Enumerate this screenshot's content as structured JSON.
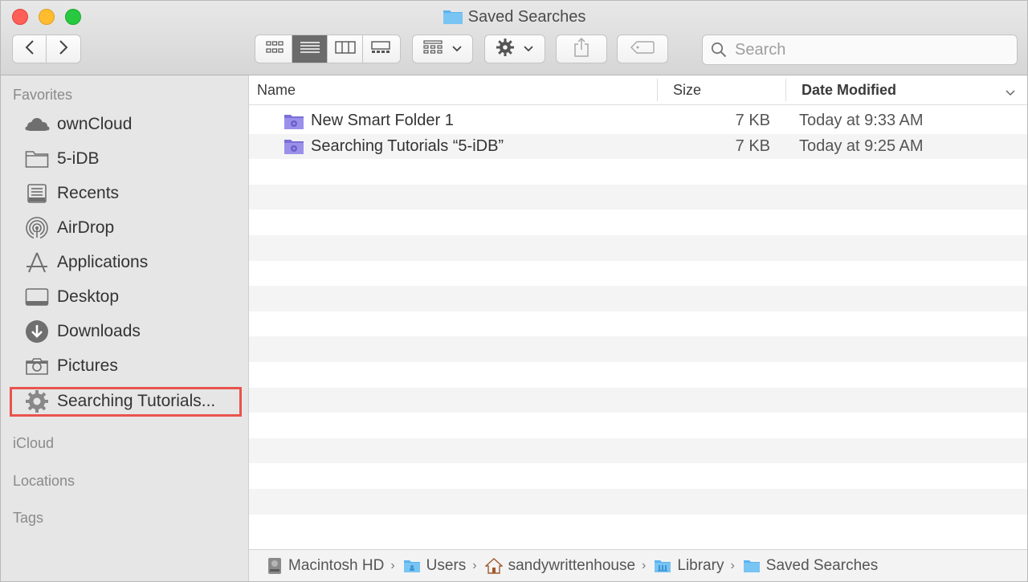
{
  "window": {
    "title": "Saved Searches"
  },
  "toolbar": {
    "back_icon": "chevron-left-icon",
    "forward_icon": "chevron-right-icon",
    "view_modes": [
      "icon-view",
      "list-view",
      "column-view",
      "gallery-view"
    ],
    "active_view": "list-view",
    "group_icon": "group-by-icon",
    "action_icon": "gear-icon",
    "share_icon": "share-icon",
    "tag_icon": "tag-icon",
    "search_placeholder": "Search"
  },
  "sidebar": {
    "favorites_label": "Favorites",
    "items": [
      {
        "label": "ownCloud",
        "icon": "cloud-icon"
      },
      {
        "label": "5-iDB",
        "icon": "folder-icon"
      },
      {
        "label": "Recents",
        "icon": "recents-icon"
      },
      {
        "label": "AirDrop",
        "icon": "airdrop-icon"
      },
      {
        "label": "Applications",
        "icon": "applications-icon"
      },
      {
        "label": "Desktop",
        "icon": "desktop-icon"
      },
      {
        "label": "Downloads",
        "icon": "downloads-icon"
      },
      {
        "label": "Pictures",
        "icon": "camera-icon"
      },
      {
        "label": "Searching Tutorials...",
        "icon": "gear-icon",
        "highlighted": true
      }
    ],
    "icloud_label": "iCloud",
    "locations_label": "Locations",
    "tags_label": "Tags"
  },
  "list": {
    "columns": {
      "name": "Name",
      "size": "Size",
      "date": "Date Modified"
    },
    "rows": [
      {
        "name": "New Smart Folder 1",
        "size": "7 KB",
        "date": "Today at 9:33 AM"
      },
      {
        "name": "Searching Tutorials “5-iDB”",
        "size": "7 KB",
        "date": "Today at 9:25 AM"
      }
    ]
  },
  "pathbar": {
    "crumbs": [
      {
        "label": "Macintosh HD",
        "icon": "hard-drive-icon"
      },
      {
        "label": "Users",
        "icon": "folder-icon"
      },
      {
        "label": "sandywrittenhouse",
        "icon": "home-icon"
      },
      {
        "label": "Library",
        "icon": "library-folder-icon"
      },
      {
        "label": "Saved Searches",
        "icon": "folder-icon"
      }
    ]
  },
  "colors": {
    "highlight_border": "#e9534e",
    "smart_folder": "#8f84e6",
    "folder_blue": "#5ab4ef"
  }
}
